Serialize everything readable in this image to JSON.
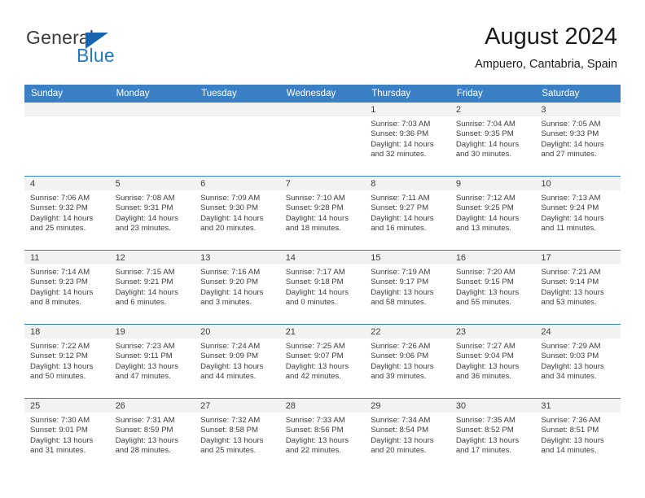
{
  "brand": {
    "name_part1": "General",
    "name_part2": "Blue",
    "triangle_color": "#1565b0",
    "blue_color": "#1f7bc4"
  },
  "header": {
    "title": "August 2024",
    "subtitle": "Ampuero, Cantabria, Spain"
  },
  "theme": {
    "header_bg": "#3b7fc4",
    "header_text": "#ffffff",
    "daynum_band_bg": "#f2f2f2",
    "cell_text": "#3d3d3d",
    "row_divider": "#3b7fc4"
  },
  "weekdays": [
    "Sunday",
    "Monday",
    "Tuesday",
    "Wednesday",
    "Thursday",
    "Friday",
    "Saturday"
  ],
  "labels": {
    "sunrise_prefix": "Sunrise:",
    "sunset_prefix": "Sunset:",
    "daylight_prefix": "Daylight:"
  },
  "weeks": [
    [
      {
        "day": "",
        "empty": true
      },
      {
        "day": "",
        "empty": true
      },
      {
        "day": "",
        "empty": true
      },
      {
        "day": "",
        "empty": true
      },
      {
        "day": "1",
        "sunrise": "Sunrise: 7:03 AM",
        "sunset": "Sunset: 9:36 PM",
        "daylight1": "Daylight: 14 hours",
        "daylight2": "and 32 minutes."
      },
      {
        "day": "2",
        "sunrise": "Sunrise: 7:04 AM",
        "sunset": "Sunset: 9:35 PM",
        "daylight1": "Daylight: 14 hours",
        "daylight2": "and 30 minutes."
      },
      {
        "day": "3",
        "sunrise": "Sunrise: 7:05 AM",
        "sunset": "Sunset: 9:33 PM",
        "daylight1": "Daylight: 14 hours",
        "daylight2": "and 27 minutes."
      }
    ],
    [
      {
        "day": "4",
        "sunrise": "Sunrise: 7:06 AM",
        "sunset": "Sunset: 9:32 PM",
        "daylight1": "Daylight: 14 hours",
        "daylight2": "and 25 minutes."
      },
      {
        "day": "5",
        "sunrise": "Sunrise: 7:08 AM",
        "sunset": "Sunset: 9:31 PM",
        "daylight1": "Daylight: 14 hours",
        "daylight2": "and 23 minutes."
      },
      {
        "day": "6",
        "sunrise": "Sunrise: 7:09 AM",
        "sunset": "Sunset: 9:30 PM",
        "daylight1": "Daylight: 14 hours",
        "daylight2": "and 20 minutes."
      },
      {
        "day": "7",
        "sunrise": "Sunrise: 7:10 AM",
        "sunset": "Sunset: 9:28 PM",
        "daylight1": "Daylight: 14 hours",
        "daylight2": "and 18 minutes."
      },
      {
        "day": "8",
        "sunrise": "Sunrise: 7:11 AM",
        "sunset": "Sunset: 9:27 PM",
        "daylight1": "Daylight: 14 hours",
        "daylight2": "and 16 minutes."
      },
      {
        "day": "9",
        "sunrise": "Sunrise: 7:12 AM",
        "sunset": "Sunset: 9:25 PM",
        "daylight1": "Daylight: 14 hours",
        "daylight2": "and 13 minutes."
      },
      {
        "day": "10",
        "sunrise": "Sunrise: 7:13 AM",
        "sunset": "Sunset: 9:24 PM",
        "daylight1": "Daylight: 14 hours",
        "daylight2": "and 11 minutes."
      }
    ],
    [
      {
        "day": "11",
        "sunrise": "Sunrise: 7:14 AM",
        "sunset": "Sunset: 9:23 PM",
        "daylight1": "Daylight: 14 hours",
        "daylight2": "and 8 minutes."
      },
      {
        "day": "12",
        "sunrise": "Sunrise: 7:15 AM",
        "sunset": "Sunset: 9:21 PM",
        "daylight1": "Daylight: 14 hours",
        "daylight2": "and 6 minutes."
      },
      {
        "day": "13",
        "sunrise": "Sunrise: 7:16 AM",
        "sunset": "Sunset: 9:20 PM",
        "daylight1": "Daylight: 14 hours",
        "daylight2": "and 3 minutes."
      },
      {
        "day": "14",
        "sunrise": "Sunrise: 7:17 AM",
        "sunset": "Sunset: 9:18 PM",
        "daylight1": "Daylight: 14 hours",
        "daylight2": "and 0 minutes."
      },
      {
        "day": "15",
        "sunrise": "Sunrise: 7:19 AM",
        "sunset": "Sunset: 9:17 PM",
        "daylight1": "Daylight: 13 hours",
        "daylight2": "and 58 minutes."
      },
      {
        "day": "16",
        "sunrise": "Sunrise: 7:20 AM",
        "sunset": "Sunset: 9:15 PM",
        "daylight1": "Daylight: 13 hours",
        "daylight2": "and 55 minutes."
      },
      {
        "day": "17",
        "sunrise": "Sunrise: 7:21 AM",
        "sunset": "Sunset: 9:14 PM",
        "daylight1": "Daylight: 13 hours",
        "daylight2": "and 53 minutes."
      }
    ],
    [
      {
        "day": "18",
        "sunrise": "Sunrise: 7:22 AM",
        "sunset": "Sunset: 9:12 PM",
        "daylight1": "Daylight: 13 hours",
        "daylight2": "and 50 minutes."
      },
      {
        "day": "19",
        "sunrise": "Sunrise: 7:23 AM",
        "sunset": "Sunset: 9:11 PM",
        "daylight1": "Daylight: 13 hours",
        "daylight2": "and 47 minutes."
      },
      {
        "day": "20",
        "sunrise": "Sunrise: 7:24 AM",
        "sunset": "Sunset: 9:09 PM",
        "daylight1": "Daylight: 13 hours",
        "daylight2": "and 44 minutes."
      },
      {
        "day": "21",
        "sunrise": "Sunrise: 7:25 AM",
        "sunset": "Sunset: 9:07 PM",
        "daylight1": "Daylight: 13 hours",
        "daylight2": "and 42 minutes."
      },
      {
        "day": "22",
        "sunrise": "Sunrise: 7:26 AM",
        "sunset": "Sunset: 9:06 PM",
        "daylight1": "Daylight: 13 hours",
        "daylight2": "and 39 minutes."
      },
      {
        "day": "23",
        "sunrise": "Sunrise: 7:27 AM",
        "sunset": "Sunset: 9:04 PM",
        "daylight1": "Daylight: 13 hours",
        "daylight2": "and 36 minutes."
      },
      {
        "day": "24",
        "sunrise": "Sunrise: 7:29 AM",
        "sunset": "Sunset: 9:03 PM",
        "daylight1": "Daylight: 13 hours",
        "daylight2": "and 34 minutes."
      }
    ],
    [
      {
        "day": "25",
        "sunrise": "Sunrise: 7:30 AM",
        "sunset": "Sunset: 9:01 PM",
        "daylight1": "Daylight: 13 hours",
        "daylight2": "and 31 minutes."
      },
      {
        "day": "26",
        "sunrise": "Sunrise: 7:31 AM",
        "sunset": "Sunset: 8:59 PM",
        "daylight1": "Daylight: 13 hours",
        "daylight2": "and 28 minutes."
      },
      {
        "day": "27",
        "sunrise": "Sunrise: 7:32 AM",
        "sunset": "Sunset: 8:58 PM",
        "daylight1": "Daylight: 13 hours",
        "daylight2": "and 25 minutes."
      },
      {
        "day": "28",
        "sunrise": "Sunrise: 7:33 AM",
        "sunset": "Sunset: 8:56 PM",
        "daylight1": "Daylight: 13 hours",
        "daylight2": "and 22 minutes."
      },
      {
        "day": "29",
        "sunrise": "Sunrise: 7:34 AM",
        "sunset": "Sunset: 8:54 PM",
        "daylight1": "Daylight: 13 hours",
        "daylight2": "and 20 minutes."
      },
      {
        "day": "30",
        "sunrise": "Sunrise: 7:35 AM",
        "sunset": "Sunset: 8:52 PM",
        "daylight1": "Daylight: 13 hours",
        "daylight2": "and 17 minutes."
      },
      {
        "day": "31",
        "sunrise": "Sunrise: 7:36 AM",
        "sunset": "Sunset: 8:51 PM",
        "daylight1": "Daylight: 13 hours",
        "daylight2": "and 14 minutes."
      }
    ]
  ]
}
